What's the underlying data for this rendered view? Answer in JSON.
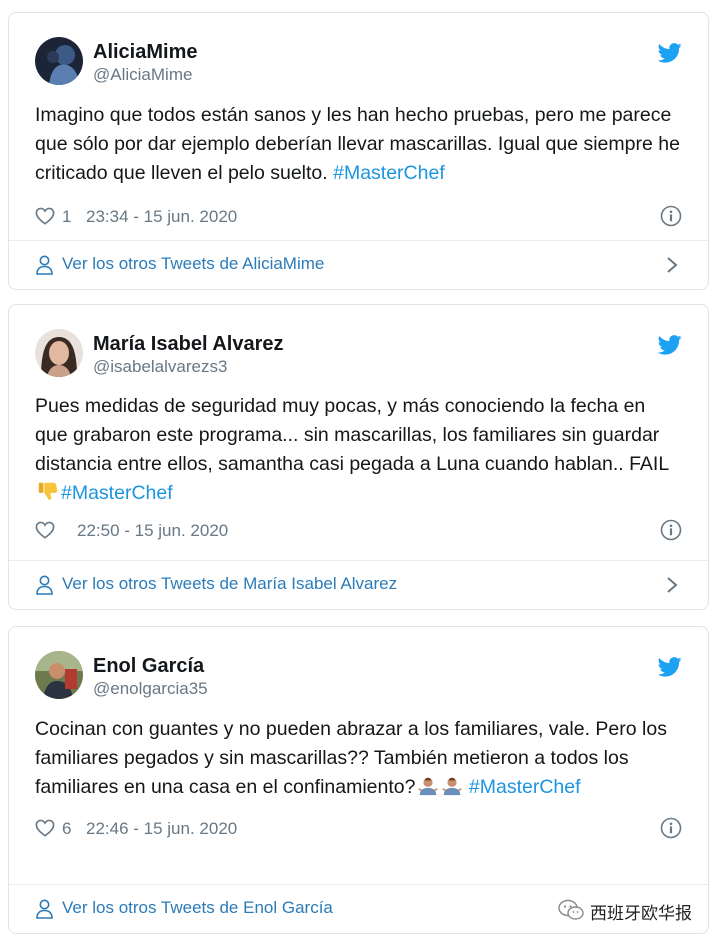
{
  "tweets": [
    {
      "name": "AliciaMime",
      "handle": "@AliciaMime",
      "text": "Imagino que todos están sanos y les han hecho pruebas, pero me parece que sólo por dar ejemplo deberían llevar mascarillas. Igual que siempre he criticado que lleven el pelo suelto.",
      "hashtag": "#MasterChef",
      "likes": "1",
      "timestamp": "23:34 - 15 jun. 2020",
      "more_link": "Ver los otros Tweets de AliciaMime"
    },
    {
      "name": "María Isabel Alvarez",
      "handle": "@isabelalvarezs3",
      "text": "Pues medidas de seguridad muy pocas, y más conociendo la fecha en que grabaron este programa... sin mascarillas, los familiares sin guardar distancia entre ellos, samantha casi pegada a Luna cuando hablan.. FAIL",
      "emoji": "thumbs-down",
      "hashtag": "#MasterChef",
      "likes": "",
      "timestamp": "22:50 - 15 jun. 2020",
      "more_link": "Ver los otros Tweets de María Isabel Alvarez"
    },
    {
      "name": "Enol García",
      "handle": "@enolgarcia35",
      "text": "Cocinan con guantes y no pueden abrazar a los familiares, vale. Pero los familiares pegados y sin mascarillas?? También metieron a todos los familiares en una casa en el confinamiento?",
      "emoji": "person-shrugging x2",
      "hashtag": "#MasterChef",
      "likes": "6",
      "timestamp": "22:46 - 15 jun. 2020",
      "more_link": "Ver los otros Tweets de Enol García"
    }
  ],
  "watermark": {
    "text": "西班牙欧华报",
    "icon": "wechat-icon"
  },
  "colors": {
    "link": "#2b7bb9",
    "hashtag": "#1b95e0",
    "twitter_blue": "#1da1f2",
    "muted": "#687885",
    "border": "#dfe3e8"
  }
}
